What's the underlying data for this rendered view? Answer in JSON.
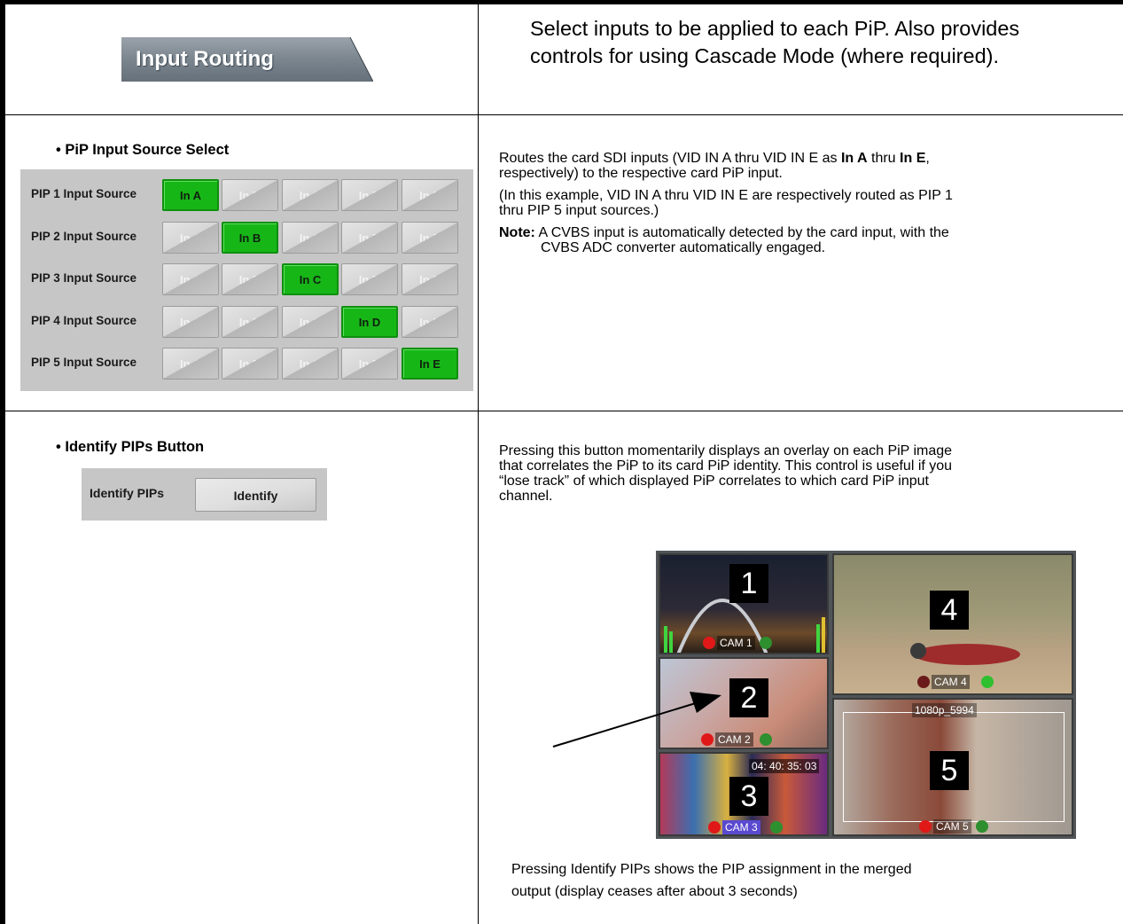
{
  "header": {
    "tab_label": "Input Routing",
    "description": "Select inputs to be applied to each PiP. Also provides controls for using Cascade Mode (where required)."
  },
  "pip_section": {
    "heading": "• PiP Input Source Select",
    "rows": [
      {
        "label": "PIP 1 Input Source",
        "selected": 0
      },
      {
        "label": "PIP 2 Input Source",
        "selected": 1
      },
      {
        "label": "PIP 3 Input Source",
        "selected": 2
      },
      {
        "label": "PIP 4 Input Source",
        "selected": 3
      },
      {
        "label": "PIP 5 Input Source",
        "selected": 4
      }
    ],
    "options": [
      "In A",
      "In B",
      "In C",
      "In D",
      "In E"
    ],
    "desc_p1_a": "Routes the card SDI inputs (VID IN A thru VID IN E as ",
    "desc_p1_b1": "In A",
    "desc_p1_c": " thru ",
    "desc_p1_b2": "In E",
    "desc_p1_d": ",",
    "desc_p1_e": "respectively) to the respective card PiP input.",
    "desc_p2_l1": "(In this example, VID IN A thru VID IN E are respectively routed as PIP 1",
    "desc_p2_l2": "thru PIP 5 input sources.)",
    "note_label": "Note:",
    "note_l1": " A CVBS input is automatically detected by the card input, with the",
    "note_l2": "CVBS ADC converter automatically engaged."
  },
  "identify_section": {
    "heading": "• Identify PIPs Button",
    "label": "Identify PIPs",
    "button": "Identify",
    "desc_l1": "Pressing this button momentarily displays an overlay on each PiP image",
    "desc_l2": "that correlates the PiP to its card PiP identity. This control is useful if you",
    "desc_l3": "“lose track” of which displayed PiP correlates to which card PiP input",
    "desc_l4": "channel.",
    "caption_l1": "Pressing Identify PIPs shows the PIP assignment in the merged",
    "caption_l2": "output (display ceases after about 3 seconds)"
  },
  "multiviewer": {
    "tiles": [
      {
        "number": "1",
        "cam": "CAM 1"
      },
      {
        "number": "2",
        "cam": "CAM 2"
      },
      {
        "number": "3",
        "cam": "CAM 3",
        "timecode": "04: 40: 35: 03"
      },
      {
        "number": "4",
        "cam": "CAM 4"
      },
      {
        "number": "5",
        "cam": "CAM 5",
        "format": "1080p_5994"
      }
    ]
  }
}
